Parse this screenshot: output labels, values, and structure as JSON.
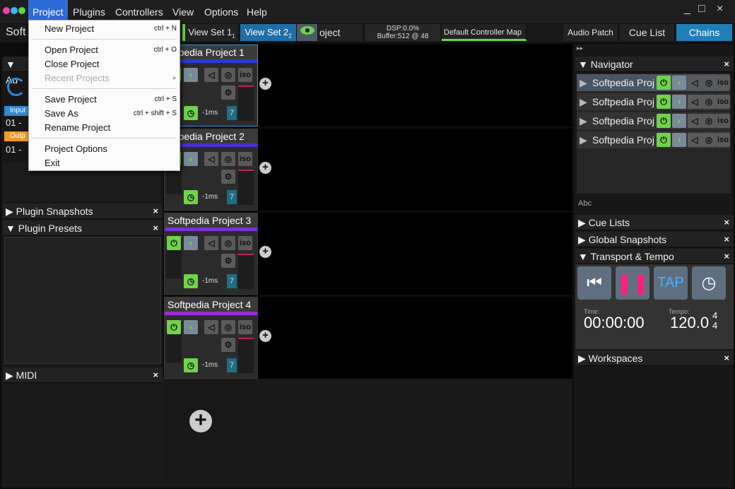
{
  "menubar": {
    "items": [
      "Project",
      "Plugins",
      "Controllers",
      "View",
      "Options",
      "Help"
    ],
    "window_controls": [
      "_",
      "□",
      "×"
    ]
  },
  "toolbar": {
    "left_label": "Soft",
    "view_set_1": "View Set 1",
    "view_set_1_num": "1",
    "view_set_2": "View Set 2",
    "view_set_2_num": "2",
    "project_fragment": "oject",
    "dsp": "DSP:0.0%",
    "buffer": "Buffer:512 @ 48",
    "controller_map": "Default Controller Map",
    "audio_patch": "Audio Patch",
    "cue_list": "Cue List",
    "chains": "Chains"
  },
  "project_menu": {
    "items": [
      {
        "label": "New Project",
        "shortcut": "ctrl + N",
        "enabled": true
      },
      {
        "label": "Open Project",
        "shortcut": "ctrl + O",
        "enabled": true
      },
      {
        "label": "Close Project",
        "shortcut": "",
        "enabled": true
      },
      {
        "label": "Recent Projects",
        "shortcut": "",
        "enabled": false
      },
      {
        "label": "Save Project",
        "shortcut": "ctrl + S",
        "enabled": true
      },
      {
        "label": "Save As",
        "shortcut": "ctrl + shift + S",
        "enabled": true
      },
      {
        "label": "Rename Project",
        "shortcut": "",
        "enabled": true
      },
      {
        "label": "Project Options",
        "shortcut": "",
        "enabled": true
      },
      {
        "label": "Exit",
        "shortcut": "",
        "enabled": true
      }
    ]
  },
  "left_sidebar": {
    "audio_header": "Au",
    "input_badge": "Input",
    "input_value": "01 -",
    "output_badge": "Outp",
    "output_value": "01 -",
    "plugin_snapshots": "Plugin Snapshots",
    "plugin_presets": "Plugin Presets",
    "midi": "MIDI",
    "close": "×"
  },
  "tracks": [
    {
      "title": "oftpedia Project 1",
      "color": "#2a3bd6",
      "latency": "-1ms",
      "num": "7",
      "selected": true
    },
    {
      "title": "oftpedia Project 2",
      "color": "#4a2fd0",
      "latency": "-1ms",
      "num": "7",
      "selected": false
    },
    {
      "title": "Softpedia Project 3",
      "color": "#7a2fd8",
      "latency": "-1ms",
      "num": "7",
      "selected": false
    },
    {
      "title": "Softpedia Project 4",
      "color": "#9a2fd8",
      "latency": "-1ms",
      "num": "7",
      "selected": false
    }
  ],
  "track_icons": {
    "power": "⏻",
    "iso": "iso",
    "gear": "⚙",
    "clock": "◷"
  },
  "navigator": {
    "header": "Navigator",
    "rows": [
      "Softpedia Proj",
      "Softpedia Proj",
      "Softpedia Proj",
      "Softpedia Proj"
    ],
    "footer": "Abc",
    "close": "×"
  },
  "right_panels": {
    "cue_lists": "Cue Lists",
    "global_snapshots": "Global Snapshots",
    "transport": "Transport & Tempo",
    "workspaces": "Workspaces"
  },
  "transport": {
    "tap_label": "TAP",
    "time_label": "Time:",
    "time_value": "00:00:00",
    "tempo_label": "Tempo:",
    "tempo_value": "120.0",
    "sig_top": "4",
    "sig_bottom": "4"
  },
  "colors": {
    "accent_blue": "#1f6ea6",
    "power_green": "#6fd34a",
    "pause_pink": "#ff1f7a",
    "menu_highlight": "#2f6bd8"
  }
}
